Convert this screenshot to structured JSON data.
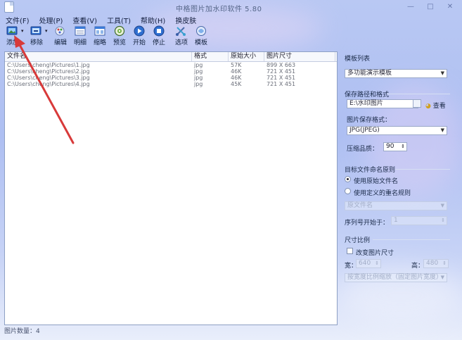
{
  "window": {
    "title": "中格图片加水印软件 5.80",
    "controls": [
      "—",
      "□",
      "✕"
    ]
  },
  "menu": [
    "文件(F)",
    "处理(P)",
    "查看(V)",
    "工具(T)",
    "帮助(H)",
    "换皮肤"
  ],
  "toolbar": [
    {
      "label": "添加",
      "icon": "add-image-icon"
    },
    {
      "label": "移除",
      "icon": "remove-image-icon"
    },
    {
      "label": "编辑",
      "icon": "edit-icon"
    },
    {
      "label": "明细",
      "icon": "details-icon"
    },
    {
      "label": "缩略",
      "icon": "thumbnail-icon"
    },
    {
      "label": "预览",
      "icon": "preview-icon"
    },
    {
      "label": "开始",
      "icon": "play-icon"
    },
    {
      "label": "停止",
      "icon": "stop-icon"
    },
    {
      "label": "选项",
      "icon": "options-icon"
    },
    {
      "label": "模板",
      "icon": "template-icon"
    }
  ],
  "file_list": {
    "columns": [
      "文件名",
      "格式",
      "原始大小",
      "图片尺寸"
    ],
    "rows": [
      [
        "C:\\Users\\cheng\\Pictures\\1.jpg",
        "jpg",
        "57K",
        "899 X 663"
      ],
      [
        "C:\\Users\\cheng\\Pictures\\2.jpg",
        "jpg",
        "46K",
        "721 X 451"
      ],
      [
        "C:\\Users\\cheng\\Pictures\\3.jpg",
        "jpg",
        "46K",
        "721 X 451"
      ],
      [
        "C:\\Users\\cheng\\Pictures\\4.jpg",
        "jpg",
        "45K",
        "721 X 451"
      ]
    ]
  },
  "status": "图片数量：4",
  "panel": {
    "template_list_label": "模板列表",
    "template_value": "多功能演示模板",
    "save_group_label": "保存路径和格式",
    "save_path": "E:\\水印图片",
    "view_label": "查看",
    "format_label": "图片保存格式：",
    "format_value": "JPG(JPEG)",
    "quality_label": "压缩品质：",
    "quality_value": "90",
    "naming_group_label": "目标文件命名原则",
    "radio_original": "使用原始文件名",
    "radio_custom": "使用定义的重名规则",
    "name_rule_value": "原文件名",
    "seq_label": "序列号开始于：",
    "seq_value": "1",
    "size_group_label": "尺寸比例",
    "change_size_label": "改变图片尺寸",
    "width_label": "宽：",
    "width_value": "640",
    "height_label": "高：",
    "height_value": "480",
    "scale_mode_value": "按宽度比例缩放（固定图片宽度）"
  },
  "colors": {
    "accent_red": "#d83a3a",
    "panel_border": "#8ea0c4"
  }
}
